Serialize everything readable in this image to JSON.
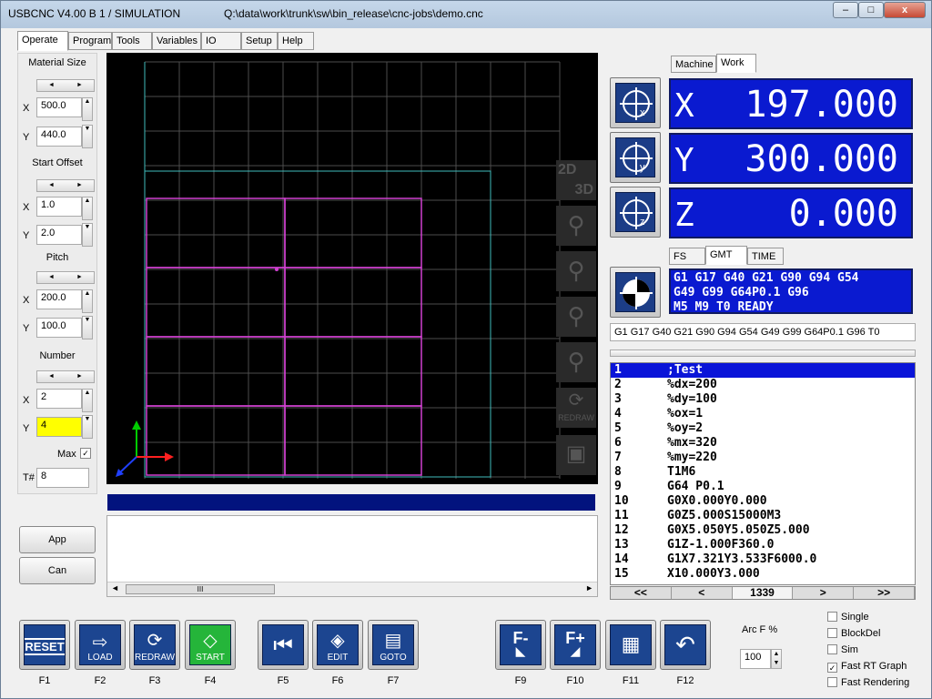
{
  "window": {
    "title": "USBCNC V4.00 B 1 / SIMULATION",
    "path": "Q:\\data\\work\\trunk\\sw\\bin_release\\cnc-jobs\\demo.cnc",
    "min": "–",
    "max": "□",
    "close": "x"
  },
  "tabs": [
    "Operate",
    "Program",
    "Tools",
    "Variables",
    "IO",
    "Setup",
    "Help"
  ],
  "left": {
    "material": {
      "title": "Material Size",
      "x": "500.0",
      "y": "440.0"
    },
    "start": {
      "title": "Start Offset",
      "x": "1.0",
      "y": "2.0"
    },
    "pitch": {
      "title": "Pitch",
      "x": "200.0",
      "y": "100.0"
    },
    "number": {
      "title": "Number",
      "x": "2",
      "y": "4",
      "max_label": "Max",
      "t_label": "T#",
      "t_value": "8"
    },
    "x_label": "X",
    "y_label": "Y",
    "app_button": "App",
    "can_button": "Can"
  },
  "view": {
    "b2d": "2D",
    "b3d": "3D",
    "redraw": "REDRAW"
  },
  "coord_tabs": [
    "Machine",
    "Work"
  ],
  "dro": [
    {
      "axis": "X",
      "value": "197.000"
    },
    {
      "axis": "Y",
      "value": "300.000"
    },
    {
      "axis": "Z",
      "value": "0.000"
    }
  ],
  "info_tabs": [
    "FS",
    "GMT",
    "TIME"
  ],
  "gcode_lines": [
    "G1 G17 G40 G21 G90 G94 G54",
    "G49 G99 G64P0.1 G96",
    "M5 M9 T0 READY"
  ],
  "gcode_status": "G1 G17 G40 G21 G90 G94 G54 G49 G99 G64P0.1 G96  T0",
  "program": [
    {
      "n": "1",
      "c": ";Test"
    },
    {
      "n": "2",
      "c": "%dx=200"
    },
    {
      "n": "3",
      "c": "%dy=100"
    },
    {
      "n": "4",
      "c": "%ox=1"
    },
    {
      "n": "5",
      "c": "%oy=2"
    },
    {
      "n": "6",
      "c": "%mx=320"
    },
    {
      "n": "7",
      "c": "%my=220"
    },
    {
      "n": "8",
      "c": "T1M6"
    },
    {
      "n": "9",
      "c": "G64 P0.1"
    },
    {
      "n": "10",
      "c": "G0X0.000Y0.000"
    },
    {
      "n": "11",
      "c": "G0Z5.000S15000M3"
    },
    {
      "n": "12",
      "c": "G0X5.050Y5.050Z5.000"
    },
    {
      "n": "13",
      "c": "G1Z-1.000F360.0"
    },
    {
      "n": "14",
      "c": "G1X7.321Y3.533F6000.0"
    },
    {
      "n": "15",
      "c": "X10.000Y3.000"
    }
  ],
  "pager": {
    "first": "<<",
    "prev": "<",
    "count": "1339",
    "next": ">",
    "last": ">>"
  },
  "hscroll_mark": "III",
  "fkeys": [
    {
      "key": "F1",
      "label": "RESET"
    },
    {
      "key": "F2",
      "label": "LOAD"
    },
    {
      "key": "F3",
      "label": "REDRAW"
    },
    {
      "key": "F4",
      "label": "START"
    },
    {
      "key": "F5",
      "label": ""
    },
    {
      "key": "F6",
      "label": "EDIT"
    },
    {
      "key": "F7",
      "label": "GOTO"
    },
    {
      "key": "F9",
      "label": "F-"
    },
    {
      "key": "F10",
      "label": "F+"
    },
    {
      "key": "F11",
      "label": ""
    },
    {
      "key": "F12",
      "label": ""
    }
  ],
  "arc": {
    "label": "Arc F %",
    "value": "100"
  },
  "checks": [
    {
      "label": "Single",
      "checked": false
    },
    {
      "label": "BlockDel",
      "checked": false
    },
    {
      "label": "Sim",
      "checked": false
    },
    {
      "label": "Fast RT Graph",
      "checked": true
    },
    {
      "label": "Fast Rendering",
      "checked": false
    }
  ],
  "colors": {
    "dro_bg": "#0a1ad0",
    "highlight_field": "#ffff00",
    "start": "#25b53a",
    "toolpath": "#d040d0",
    "grid": "#505050",
    "cyan": "#40c0c0"
  }
}
